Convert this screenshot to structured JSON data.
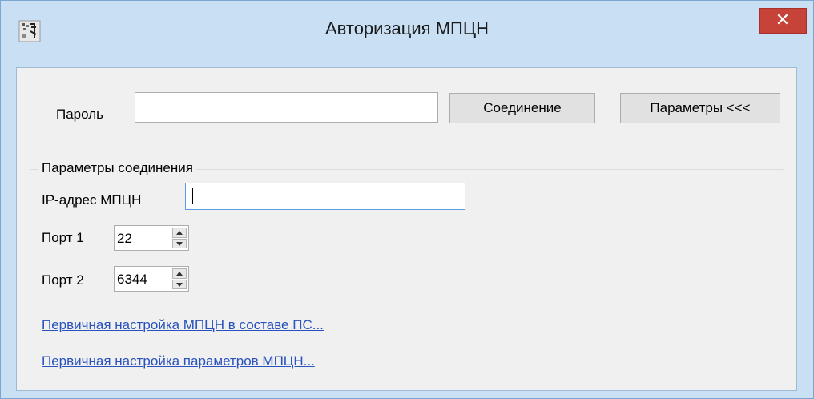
{
  "window": {
    "title": "Авторизация МПЦН",
    "close_glyph": "✕",
    "app_icon": "app-icon",
    "close_color": "#c7433a",
    "frame_color": "#c9dff3"
  },
  "auth": {
    "password_label": "Пароль",
    "password_value": "",
    "connect_button": "Соединение",
    "params_button": "Параметры <<<"
  },
  "connection": {
    "group_title": "Параметры соединения",
    "ip_label": "IP-адрес МПЦН",
    "ip_value": "",
    "port1_label": "Порт 1",
    "port1_value": "22",
    "port2_label": "Порт 2",
    "port2_value": "6344",
    "link1": "Первичная настройка МПЦН в составе ПС...",
    "link2": "Первичная настройка параметров МПЦН...",
    "link_color": "#2a52be"
  }
}
